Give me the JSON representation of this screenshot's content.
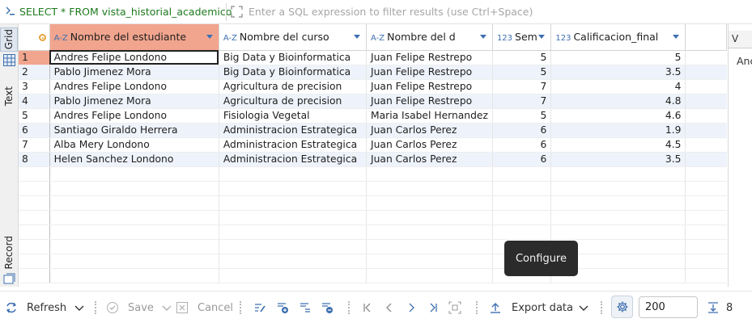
{
  "query": {
    "text": "SELECT * FROM vista_historial_academico"
  },
  "filter": {
    "placeholder": "Enter a SQL expression to filter results (use Ctrl+Space)",
    "value": ""
  },
  "left_tabs": {
    "grid": "Grid",
    "text": "Text",
    "record": "Record"
  },
  "columns": [
    {
      "label": "Nombre del estudiante",
      "type": "A-Z"
    },
    {
      "label": "Nombre del curso",
      "type": "A-Z"
    },
    {
      "label": "Nombre del d",
      "type": "A-Z"
    },
    {
      "label": "Sem",
      "type": "123"
    },
    {
      "label": "Calificacion_final",
      "type": "123"
    }
  ],
  "rows": [
    {
      "n": "1",
      "estudiante": "Andres Felipe Londono",
      "curso": "Big Data y Bioinformatica",
      "docente": "Juan Felipe Restrepo",
      "sem": "5",
      "calif": "5"
    },
    {
      "n": "2",
      "estudiante": "Pablo Jimenez Mora",
      "curso": "Big Data y Bioinformatica",
      "docente": "Juan Felipe Restrepo",
      "sem": "5",
      "calif": "3.5"
    },
    {
      "n": "3",
      "estudiante": "Andres Felipe Londono",
      "curso": "Agricultura de precision",
      "docente": "Juan Felipe Restrepo",
      "sem": "7",
      "calif": "4"
    },
    {
      "n": "4",
      "estudiante": "Pablo Jimenez Mora",
      "curso": "Agricultura de precision",
      "docente": "Juan Felipe Restrepo",
      "sem": "7",
      "calif": "4.8"
    },
    {
      "n": "5",
      "estudiante": "Andres Felipe Londono",
      "curso": "Fisiologia Vegetal",
      "docente": "Maria Isabel Hernandez",
      "sem": "5",
      "calif": "4.6"
    },
    {
      "n": "6",
      "estudiante": "Santiago Giraldo Herrera",
      "curso": "Administracion Estrategica",
      "docente": "Juan Carlos Perez",
      "sem": "6",
      "calif": "1.9"
    },
    {
      "n": "7",
      "estudiante": "Alba Mery Londono",
      "curso": "Administracion Estrategica",
      "docente": "Juan Carlos Perez",
      "sem": "6",
      "calif": "4.5"
    },
    {
      "n": "8",
      "estudiante": "Helen Sanchez Londono",
      "curso": "Administracion Estrategica",
      "docente": "Juan Carlos Perez",
      "sem": "6",
      "calif": "3.5"
    }
  ],
  "right_panel": {
    "tab": "V",
    "text": "Anc"
  },
  "tooltip": "Configure",
  "toolbar": {
    "refresh": "Refresh",
    "save": "Save",
    "cancel": "Cancel",
    "export": "Export data",
    "limit": "200",
    "count": "8"
  },
  "colors": {
    "selected_header": "#f2a58e",
    "alt_row": "#eef3fb",
    "type_icon": "#3d6fb0",
    "query_text": "#1e7a1e"
  }
}
